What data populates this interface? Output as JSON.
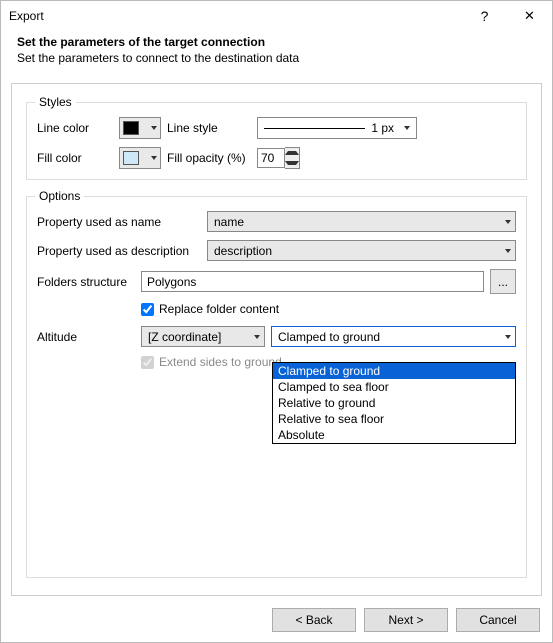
{
  "window": {
    "title": "Export",
    "help_glyph": "?",
    "close_label": ""
  },
  "header": {
    "title": "Set the parameters of the target connection",
    "subtitle": "Set the parameters to connect to the destination data"
  },
  "styles_group": {
    "legend": "Styles",
    "line_color_label": "Line color",
    "line_color_value": "#000000",
    "line_style_label": "Line style",
    "line_style_value": "1 px",
    "fill_color_label": "Fill color",
    "fill_color_value": "#cfe8f7",
    "fill_opacity_label": "Fill opacity (%)",
    "fill_opacity_value": "70"
  },
  "options_group": {
    "legend": "Options",
    "prop_name_label": "Property used as name",
    "prop_name_value": "name",
    "prop_desc_label": "Property used as description",
    "prop_desc_value": "description",
    "folders_label": "Folders structure",
    "folders_value": "Polygons",
    "browse_label": "...",
    "replace_label": "Replace folder content",
    "replace_checked": true,
    "altitude_label": "Altitude",
    "altitude_source_value": "[Z coordinate]",
    "altitude_mode_value": "Clamped to ground",
    "altitude_mode_options": [
      "Clamped to ground",
      "Clamped to sea floor",
      "Relative to ground",
      "Relative to sea floor",
      "Absolute"
    ],
    "extend_label": "Extend sides to ground",
    "extend_checked": true
  },
  "footer": {
    "back": "< Back",
    "next": "Next >",
    "cancel": "Cancel"
  }
}
